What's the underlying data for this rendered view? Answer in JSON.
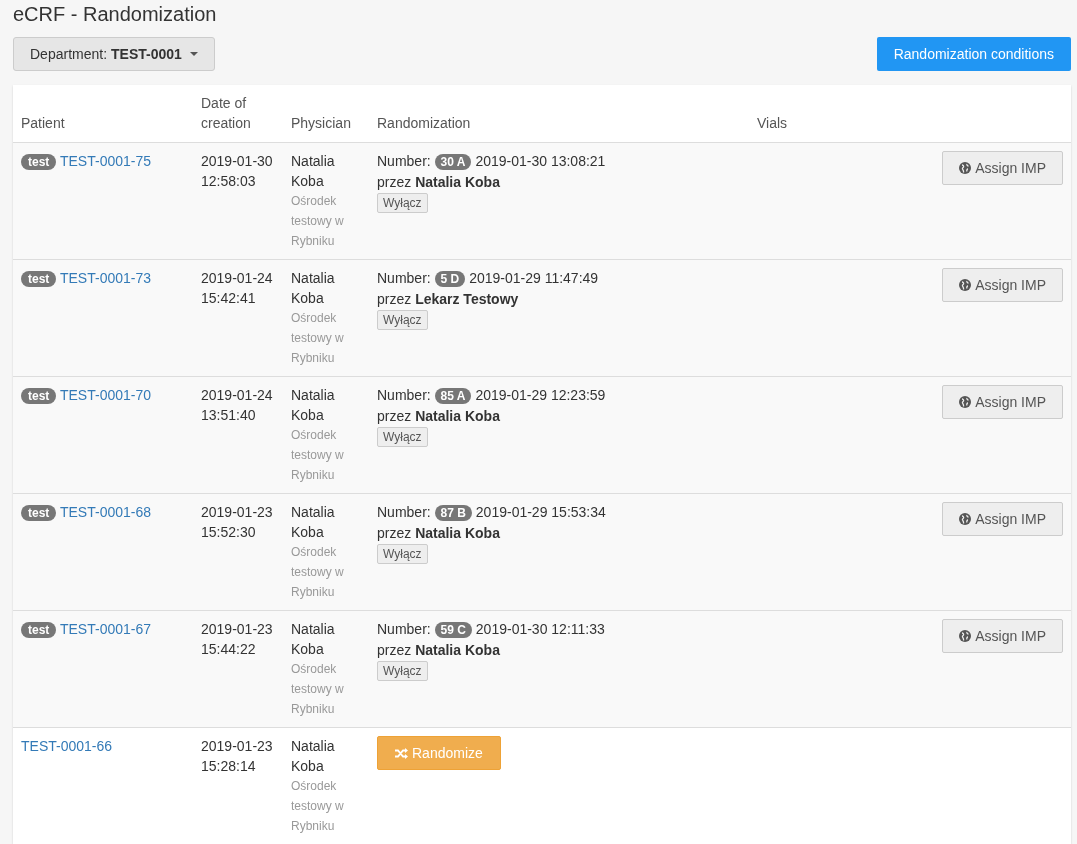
{
  "page_title": "eCRF - Randomization",
  "department": {
    "label": "Department:",
    "value": "TEST-0001"
  },
  "conditions_button": "Randomization conditions",
  "table": {
    "columns": [
      "Patient",
      "Date of creation",
      "Physician",
      "Randomization",
      "Vials"
    ],
    "rows": [
      {
        "kind": "randomized",
        "tag": "test",
        "patient": "TEST-0001-75",
        "date": "2019-01-30",
        "time": "12:58:03",
        "physician": "Natalia Koba",
        "site": "Ośrodek testowy w Rybniku",
        "number_label": "Number:",
        "number": "30 A",
        "randomized_at": "2019-01-30 13:08:21",
        "by": "przez **Natalia Koba**",
        "off_button": "Wyłącz",
        "action": "Assign IMP"
      },
      {
        "kind": "randomized",
        "tag": "test",
        "patient": "TEST-0001-73",
        "date": "2019-01-24",
        "time": "15:42:41",
        "physician": "Natalia Koba",
        "site": "Ośrodek testowy w Rybniku",
        "number_label": "Number:",
        "number": "5 D",
        "randomized_at": "2019-01-29 11:47:49",
        "by": "przez **Lekarz Testowy**",
        "off_button": "Wyłącz",
        "action": "Assign IMP"
      },
      {
        "kind": "randomized",
        "tag": "test",
        "patient": "TEST-0001-70",
        "date": "2019-01-24",
        "time": "13:51:40",
        "physician": "Natalia Koba",
        "site": "Ośrodek testowy w Rybniku",
        "number_label": "Number:",
        "number": "85 A",
        "randomized_at": "2019-01-29 12:23:59",
        "by": "przez **Natalia Koba**",
        "off_button": "Wyłącz",
        "action": "Assign IMP"
      },
      {
        "kind": "randomized",
        "tag": "test",
        "patient": "TEST-0001-68",
        "date": "2019-01-23",
        "time": "15:52:30",
        "physician": "Natalia Koba",
        "site": "Ośrodek testowy w Rybniku",
        "number_label": "Number:",
        "number": "87 B",
        "randomized_at": "2019-01-29 15:53:34",
        "by": "przez **Natalia Koba**",
        "off_button": "Wyłącz",
        "action": "Assign IMP"
      },
      {
        "kind": "randomized",
        "tag": "test",
        "patient": "TEST-0001-67",
        "date": "2019-01-23",
        "time": "15:44:22",
        "physician": "Natalia Koba",
        "site": "Ośrodek testowy w Rybniku",
        "number_label": "Number:",
        "number": "59 C",
        "randomized_at": "2019-01-30 12:11:33",
        "by": "przez **Natalia Koba**",
        "off_button": "Wyłącz",
        "action": "Assign IMP"
      },
      {
        "kind": "pending",
        "patient": "TEST-0001-66",
        "date": "2019-01-23",
        "time": "15:28:14",
        "physician": "Natalia Koba",
        "site": "Ośrodek testowy w Rybniku",
        "randomize_button": "Randomize"
      }
    ]
  }
}
